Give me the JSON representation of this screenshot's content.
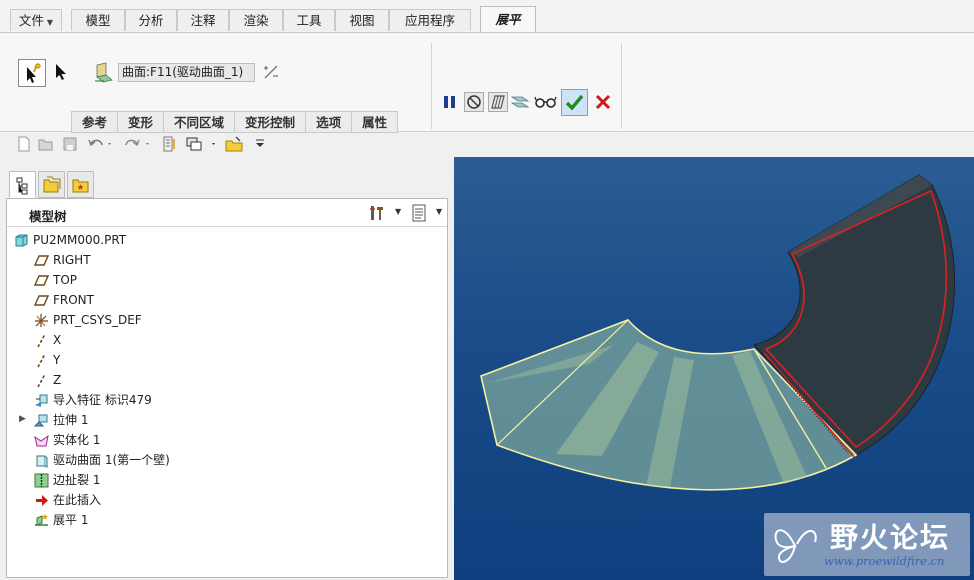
{
  "ribbon_tabs": [
    {
      "label": "文件",
      "dropdown": true
    },
    {
      "label": "模型"
    },
    {
      "label": "分析"
    },
    {
      "label": "注释"
    },
    {
      "label": "渲染"
    },
    {
      "label": "工具"
    },
    {
      "label": "视图"
    },
    {
      "label": "应用程序"
    },
    {
      "label": "展平",
      "active": true
    }
  ],
  "flatten": {
    "surface_collector_value": "曲面:F11(驱动曲面_1)",
    "subtabs": [
      "参考",
      "变形",
      "不同区域",
      "变形控制",
      "选项",
      "属性"
    ]
  },
  "model_tree": {
    "title": "模型树",
    "items": [
      {
        "label": "PU2MM000.PRT",
        "icon": "part-icon"
      },
      {
        "label": "RIGHT",
        "icon": "datum-plane-icon"
      },
      {
        "label": "TOP",
        "icon": "datum-plane-icon"
      },
      {
        "label": "FRONT",
        "icon": "datum-plane-icon"
      },
      {
        "label": "PRT_CSYS_DEF",
        "icon": "csys-icon"
      },
      {
        "label": "X",
        "icon": "datum-axis-icon"
      },
      {
        "label": "Y",
        "icon": "datum-axis-icon"
      },
      {
        "label": "Z",
        "icon": "datum-axis-icon"
      },
      {
        "label": "导入特征 标识479",
        "icon": "import-feature-icon"
      },
      {
        "label": "拉伸 1",
        "icon": "extrude-icon",
        "expandable": true
      },
      {
        "label": "实体化 1",
        "icon": "solidify-icon"
      },
      {
        "label": "驱动曲面 1(第一个壁)",
        "icon": "driving-surface-icon"
      },
      {
        "label": "边扯裂 1",
        "icon": "edge-rip-icon"
      },
      {
        "label": "在此插入",
        "icon": "insert-here-icon"
      },
      {
        "label": "展平 1",
        "icon": "flatten-icon"
      }
    ]
  },
  "watermark": {
    "title": "野火论坛",
    "url": "www.proewildfire.cn"
  },
  "colors": {
    "viewport_top": "#2c5d93",
    "viewport_bottom": "#0f3f7e",
    "flattened_surface": "#6f9a9a",
    "edge_highlight": "#f4f0a0",
    "model_edge": "#e02020"
  }
}
